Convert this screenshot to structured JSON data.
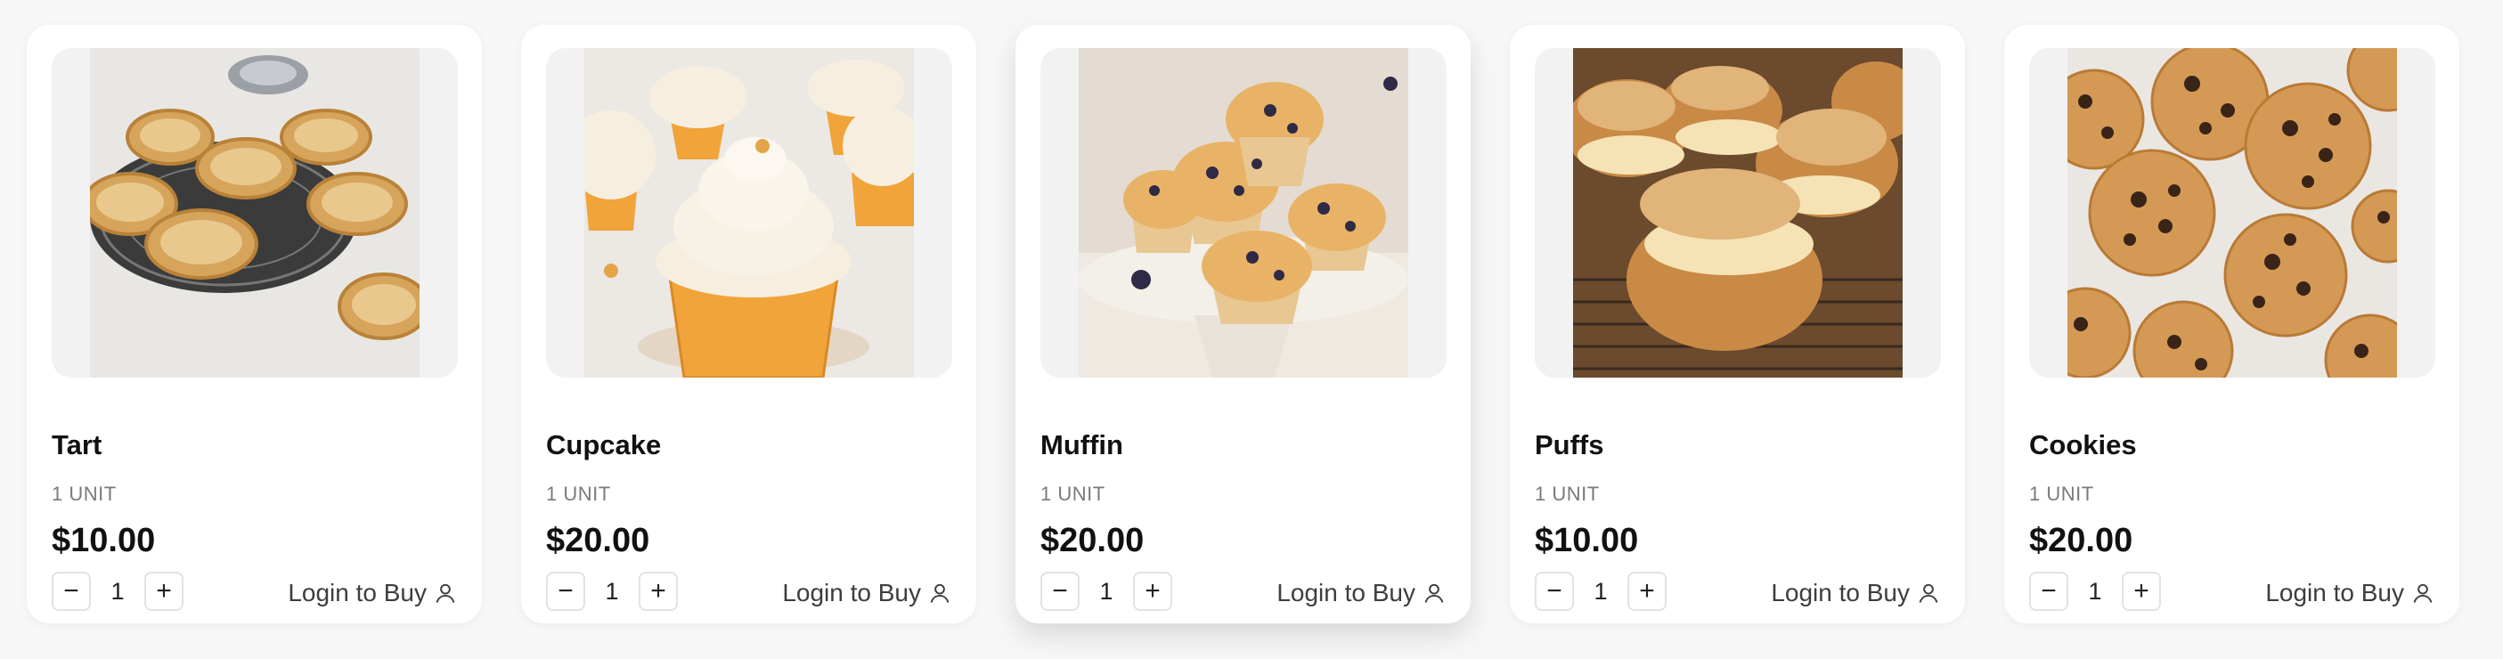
{
  "products": [
    {
      "name": "Tart",
      "unit": "1 UNIT",
      "price": "$10.00",
      "quantity": "1",
      "minus": "−",
      "plus": "+",
      "cta": "Login to Buy",
      "image_icon": "tart-image"
    },
    {
      "name": "Cupcake",
      "unit": "1 UNIT",
      "price": "$20.00",
      "quantity": "1",
      "minus": "−",
      "plus": "+",
      "cta": "Login to Buy",
      "image_icon": "cupcake-image"
    },
    {
      "name": "Muffin",
      "unit": "1 UNIT",
      "price": "$20.00",
      "quantity": "1",
      "minus": "−",
      "plus": "+",
      "cta": "Login to Buy",
      "image_icon": "muffin-image"
    },
    {
      "name": "Puffs",
      "unit": "1 UNIT",
      "price": "$10.00",
      "quantity": "1",
      "minus": "−",
      "plus": "+",
      "cta": "Login to Buy",
      "image_icon": "puffs-image"
    },
    {
      "name": "Cookies",
      "unit": "1 UNIT",
      "price": "$20.00",
      "quantity": "1",
      "minus": "−",
      "plus": "+",
      "cta": "Login to Buy",
      "image_icon": "cookies-image"
    }
  ],
  "icons": {
    "login": "user-icon"
  },
  "colors": {
    "card": "#ffffff",
    "background": "#f7f7f8",
    "text": "#111111",
    "muted": "#7a7a7a"
  }
}
